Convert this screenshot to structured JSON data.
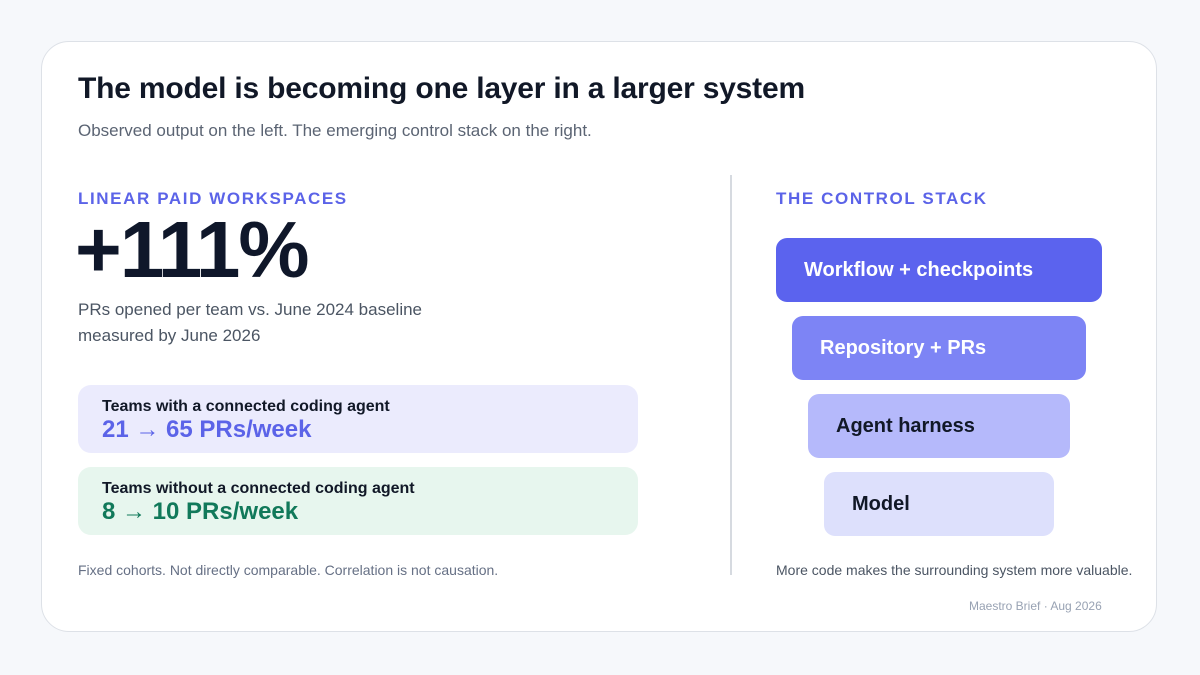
{
  "header": {
    "title": "The model is becoming one layer in a larger system",
    "subtitle": "Observed output on the left. The emerging control stack on the right."
  },
  "left": {
    "label": "LINEAR PAID WORKSPACES",
    "metric": "+111%",
    "description": [
      "PRs opened per team vs. June 2024 baseline",
      "measured by June 2026"
    ],
    "cohorts": [
      {
        "title": "Teams with a connected coding agent",
        "value": "21 → 65 PRs/week"
      },
      {
        "title": "Teams without a connected coding agent",
        "value": "8 → 10 PRs/week"
      }
    ],
    "footnote": "Fixed cohorts. Not directly comparable. Correlation is not causation."
  },
  "right": {
    "label": "THE CONTROL STACK",
    "layers": [
      {
        "label": "Workflow + checkpoints"
      },
      {
        "label": "Repository + PRs"
      },
      {
        "label": "Agent harness"
      },
      {
        "label": "Model"
      }
    ],
    "footnote": "More code makes the surrounding system more valuable."
  },
  "footer": {
    "attribution": "Maestro Brief · Aug 2026"
  },
  "colors": {
    "accent": "#5b63e8",
    "positive": "#11795a",
    "background": "#f6f8fb"
  }
}
